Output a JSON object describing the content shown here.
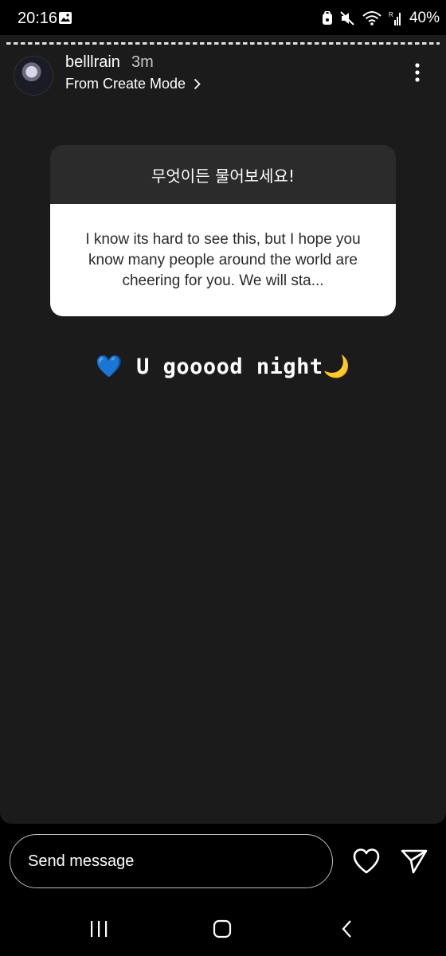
{
  "status_bar": {
    "time": "20:16",
    "battery": "40%"
  },
  "story": {
    "username": "belllrain",
    "time_ago": "3m",
    "source": "From Create Mode",
    "question_card": {
      "prompt": "무엇이든 물어보세요!",
      "answer": "I know its hard to see this, but I hope you know many people around the world are cheering for you. We will sta..."
    },
    "caption": "💙 U gooood night🌙"
  },
  "reply_bar": {
    "placeholder": "Send message"
  },
  "colors": {
    "story_bg": "#1b1b1b",
    "card_header": "#2b2b2b",
    "card_body": "#ffffff"
  },
  "icons": [
    "gallery-icon",
    "lock-icon",
    "mute-icon",
    "wifi-icon",
    "signal-icon",
    "more-icon",
    "chevron-right-icon",
    "heart-icon",
    "send-icon",
    "recents-icon",
    "home-icon",
    "back-icon"
  ]
}
